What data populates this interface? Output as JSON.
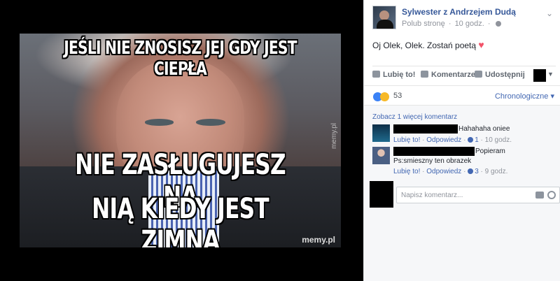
{
  "meme": {
    "top_text": "JEŚLI NIE ZNOSISZ JEJ GDY JEST CIEPŁA",
    "middle_text": "NIE ZASŁUGUJESZ NA",
    "bottom_text": "NIĄ KIEDY JEST ZIMNA",
    "watermark_side": "memy.pl",
    "watermark_bottom": "memy.pl"
  },
  "post": {
    "page_name": "Sylwester z Andrzejem Dudą",
    "like_page": "Polub stronę",
    "separator": "·",
    "time": "10 godz.",
    "text": "Oj Olek, Olek. Zostań poetą",
    "heart_icon": "heart-icon"
  },
  "actions": {
    "like": "Lubię to!",
    "comment": "Komentarze",
    "share": "Udostępnij"
  },
  "reactions": {
    "count": "53",
    "sort": "Chronologiczne"
  },
  "comments_section": {
    "more": "Zobacz 1 więcej komentarz",
    "items": [
      {
        "text": "Hahahaha oniee",
        "like": "Lubię to!",
        "reply": "Odpowiedz",
        "likes": "1",
        "time": "10 godz."
      },
      {
        "text": "Popieram",
        "text2": "Ps:smieszny ten obrazek",
        "like": "Lubię to!",
        "reply": "Odpowiedz",
        "likes": "3",
        "time": "9 godz."
      }
    ],
    "compose_placeholder": "Napisz komentarz..."
  },
  "colors": {
    "link_blue": "#365899",
    "accent_blue": "#4267b2",
    "meta_gray": "#90949c",
    "heart": "#f25268"
  }
}
